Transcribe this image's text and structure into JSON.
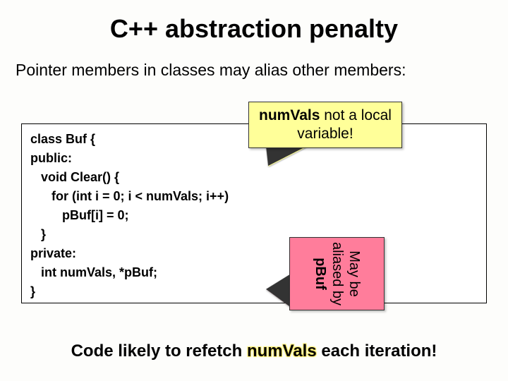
{
  "title": "C++ abstraction penalty",
  "subtitle": "Pointer members in classes may alias other members:",
  "code": {
    "l1": "class Buf {",
    "l2": "public:",
    "l3": "   void Clear() {",
    "l4": "      for (int i = 0; i < numVals; i++)",
    "l5": "         pBuf[i] = 0;",
    "l6": "   }",
    "l7": "private:",
    "l8": "   int numVals, *pBuf;",
    "l9": "}"
  },
  "callout_yellow": {
    "bold": "numVals",
    "rest": " not a local variable!"
  },
  "callout_red": {
    "line1": "May be aliased by",
    "bold": "pBuf"
  },
  "footnote": {
    "pre": "Code likely to refetch ",
    "hl": "numVals",
    "post": " each iteration!"
  }
}
